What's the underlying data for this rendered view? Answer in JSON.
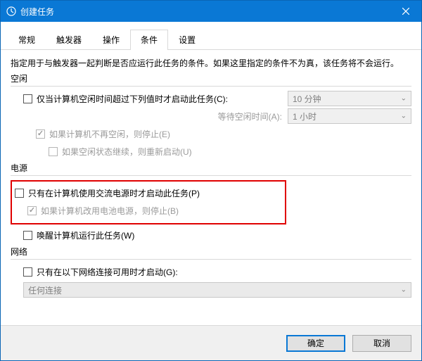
{
  "window": {
    "title": "创建任务"
  },
  "tabs": {
    "general": "常规",
    "triggers": "触发器",
    "actions": "操作",
    "conditions": "条件",
    "settings": "设置"
  },
  "desc": "指定用于与触发器一起判断是否应运行此任务的条件。如果这里指定的条件不为真，该任务将不会运行。",
  "sections": {
    "idle": "空闲",
    "power": "电源",
    "network": "网络"
  },
  "idle": {
    "start_only_if_idle": "仅当计算机空闲时间超过下列值时才启动此任务(C):",
    "wait_for_idle": "等待空闲时间(A):",
    "stop_if_not_idle": "如果计算机不再空闲，则停止(E)",
    "restart_if_idle": "如果空闲状态继续，则重新启动(U)",
    "idle_duration": "10 分钟",
    "wait_timeout": "1 小时"
  },
  "power": {
    "start_on_ac": "只有在计算机使用交流电源时才启动此任务(P)",
    "stop_on_battery": "如果计算机改用电池电源，则停止(B)",
    "wake_to_run": "唤醒计算机运行此任务(W)"
  },
  "network": {
    "start_if_connection": "只有在以下网络连接可用时才启动(G):",
    "any_connection": "任何连接"
  },
  "buttons": {
    "ok": "确定",
    "cancel": "取消"
  }
}
